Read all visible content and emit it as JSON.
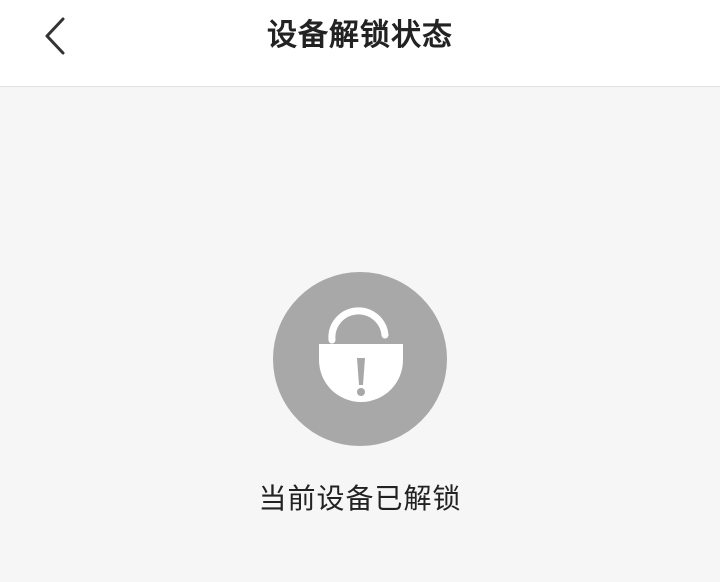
{
  "header": {
    "back_icon": "chevron-left-icon",
    "title": "设备解锁状态"
  },
  "status": {
    "icon": "unlocked-padlock-warning-icon",
    "message": "当前设备已解锁"
  },
  "colors": {
    "header_bg": "#ffffff",
    "page_bg": "#f6f6f6",
    "circle": "#a8a8a8",
    "icon_fg": "#ffffff",
    "text": "#222222"
  }
}
